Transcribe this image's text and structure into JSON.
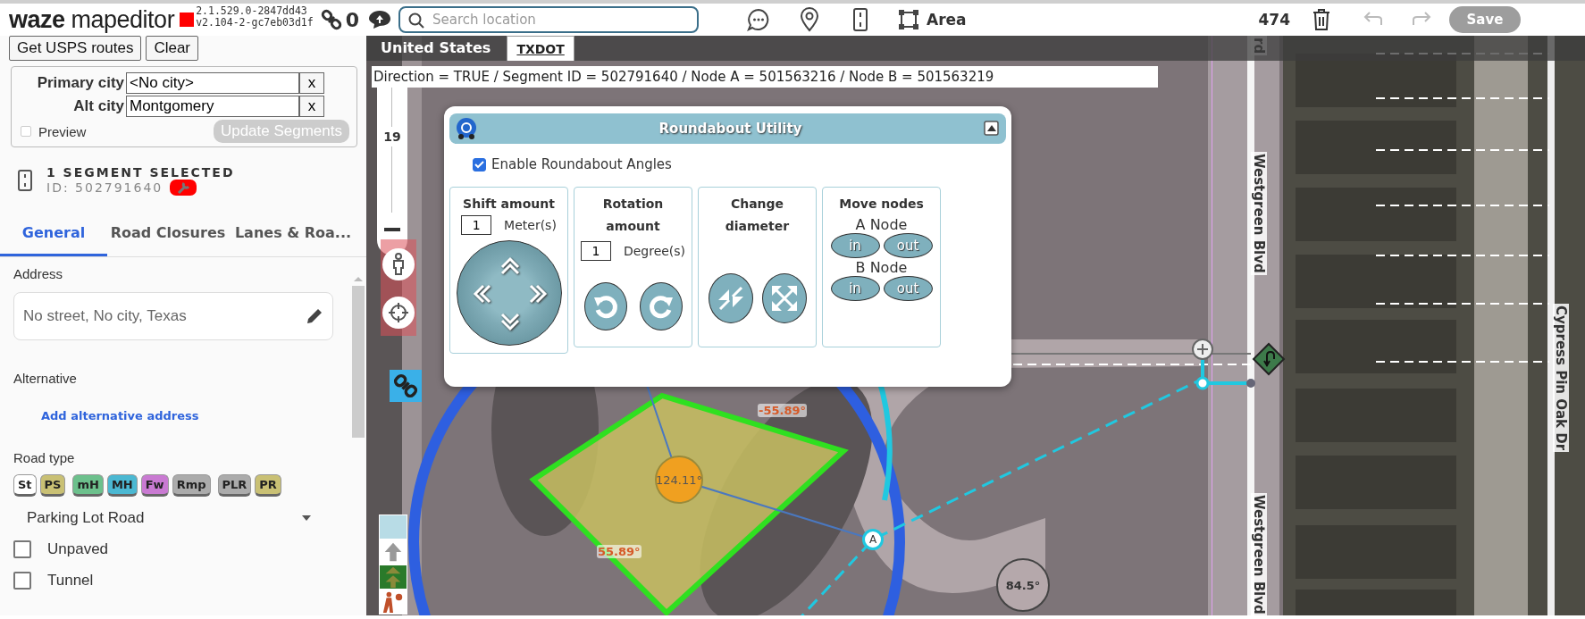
{
  "header": {
    "logo_word": "waze",
    "logo_sub": "mapeditor",
    "version_lines": [
      "2.1.529.0-2847dd43",
      "v2.104-2-gc7eb03d1f"
    ],
    "link_count": "0",
    "search": {
      "placeholder": "Search location"
    },
    "area_label": "Area",
    "edit_count": "474",
    "save": {
      "label": "Save",
      "disabled": true
    }
  },
  "usps": {
    "buttons": [
      "Get USPS routes",
      "Clear"
    ],
    "fields": [
      {
        "label": "Primary city",
        "value": "<No city>",
        "clear": "x"
      },
      {
        "label": "Alt city",
        "value": "Montgomery",
        "clear": "x"
      }
    ],
    "preview": {
      "label": "Preview",
      "checked": false
    },
    "update": {
      "label": "Update Segments",
      "disabled": true
    }
  },
  "selection": {
    "title": "1 SEGMENT SELECTED",
    "id": "ID: 502791640"
  },
  "tabs": [
    {
      "label": "General",
      "selected": true
    },
    {
      "label": "Road Closures",
      "selected": false
    },
    {
      "label": "Lanes & Roa...",
      "selected": false
    }
  ],
  "general": {
    "address_label": "Address",
    "address": "No street, No city, Texas",
    "alternative_label": "Alternative",
    "add_alt": "Add alternative address",
    "road_type_label": "Road type",
    "road_types": [
      {
        "label": "St",
        "color": "#ffffff"
      },
      {
        "label": "PS",
        "color": "#c9c074"
      },
      {
        "label": "mH",
        "color": "#6cc08c"
      },
      {
        "label": "MH",
        "color": "#4bb8d2"
      },
      {
        "label": "Fw",
        "color": "#c97ad2"
      },
      {
        "label": "Rmp",
        "color": "#ababab"
      },
      {
        "label": "PLR",
        "color": "#ababab"
      },
      {
        "label": "PR",
        "color": "#c9c074"
      }
    ],
    "road_type_value": "Parking Lot Road",
    "checkboxes": [
      {
        "label": "Unpaved",
        "checked": false
      },
      {
        "label": "Tunnel",
        "checked": false
      }
    ]
  },
  "map": {
    "country": "United States",
    "layer_tab": "TXDOT",
    "info": "Direction = TRUE / Segment ID = 502791640 / Node A = 501563216 / Node B = 501563219",
    "zoom": "19",
    "node_label": "A",
    "street_labels": [
      "rd",
      "Westgreen Blvd",
      "Westgreen Blvd",
      "Cypress Pin Oak Dr"
    ],
    "angles": [
      {
        "text": "124.11°",
        "kind": "center"
      },
      {
        "text": "-55.89°",
        "kind": "label"
      },
      {
        "text": "55.89°",
        "kind": "label"
      },
      {
        "text": "84.5°",
        "kind": "circle"
      }
    ]
  },
  "roundabout": {
    "title": "Roundabout Utility",
    "enable": {
      "label": "Enable Roundabout Angles",
      "checked": true
    },
    "sections": [
      {
        "kind": "shift",
        "title": "Shift amount",
        "value": "1",
        "unit": "Meter(s)"
      },
      {
        "kind": "rotate",
        "title": "Rotation amount",
        "value": "1",
        "unit": "Degree(s)"
      },
      {
        "kind": "diameter",
        "title": "Change diameter"
      },
      {
        "kind": "nodes",
        "title": "Move nodes",
        "nodes": [
          {
            "label": "A Node",
            "buttons": [
              "in",
              "out"
            ]
          },
          {
            "label": "B Node",
            "buttons": [
              "in",
              "out"
            ]
          }
        ]
      }
    ]
  }
}
